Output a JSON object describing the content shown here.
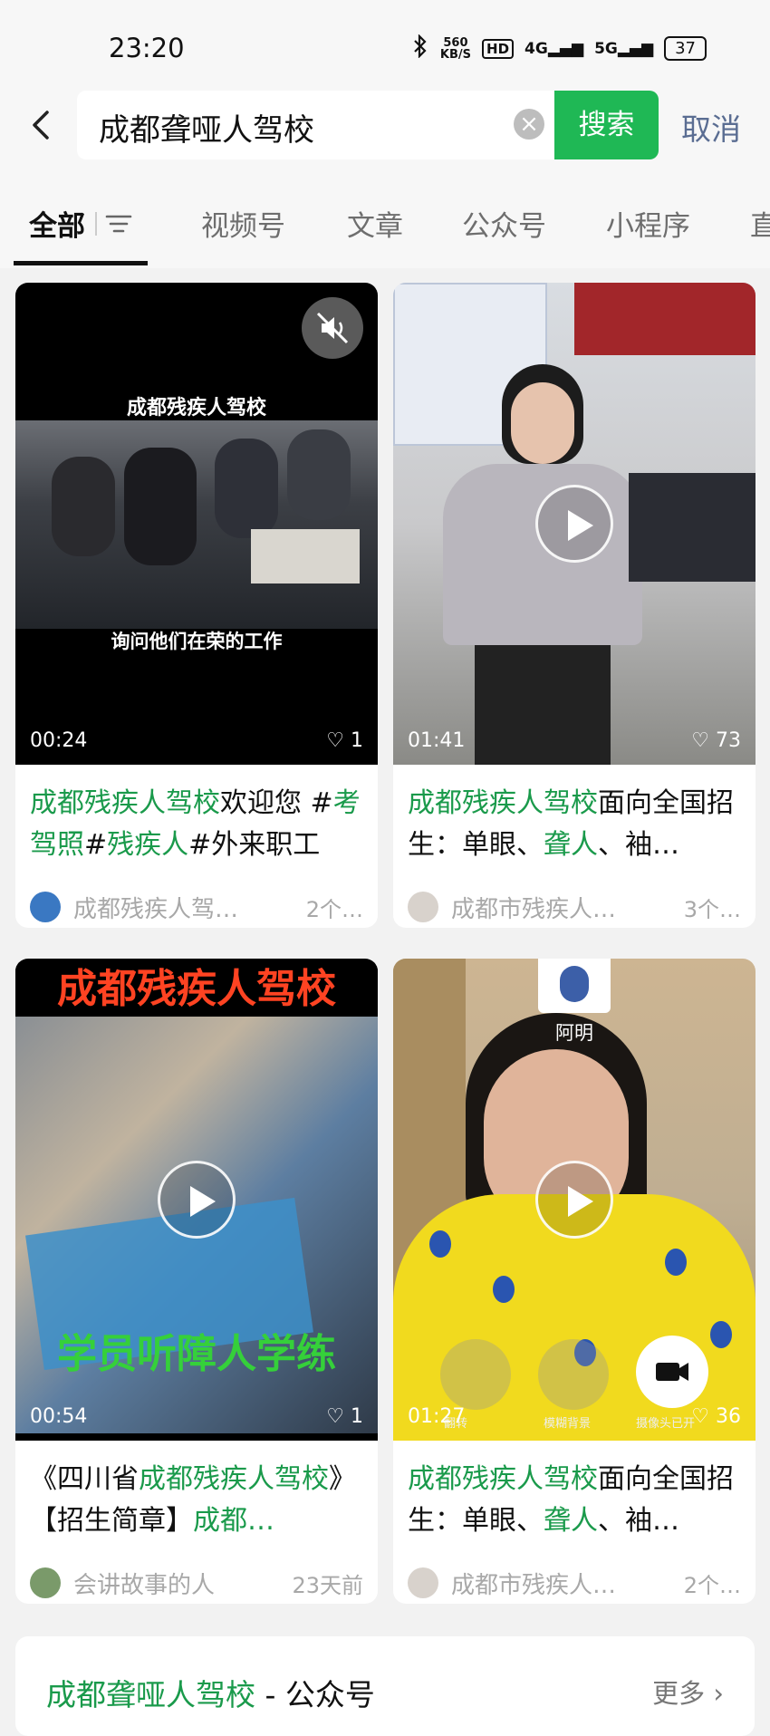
{
  "status": {
    "time": "23:20",
    "speed_top": "560",
    "speed_bottom": "KB/S",
    "hd": "HD",
    "net1": "4G",
    "net2": "5G",
    "battery": "37"
  },
  "search": {
    "query": "成都聋哑人驾校",
    "button": "搜索",
    "cancel": "取消"
  },
  "tabs": [
    "全部",
    "视频号",
    "文章",
    "公众号",
    "小程序",
    "直"
  ],
  "cards": [
    {
      "overlay_top": "成都残疾人驾校",
      "overlay_bottom": "询问他们在荣的工作",
      "duration": "00:24",
      "likes": "1",
      "caption_parts": [
        {
          "t": "成都残疾人驾校",
          "g": true
        },
        {
          "t": "欢迎您 #",
          "g": false
        },
        {
          "t": "考驾照",
          "g": true
        },
        {
          "t": "#",
          "g": false
        },
        {
          "t": "残疾人",
          "g": true
        },
        {
          "t": "#外来职工",
          "g": false
        }
      ],
      "author": "成都残疾人驾…",
      "ago": "2个…"
    },
    {
      "duration": "01:41",
      "likes": "73",
      "caption_parts": [
        {
          "t": "成都残疾人驾校",
          "g": true
        },
        {
          "t": "面向全国招生：单眼、",
          "g": false
        },
        {
          "t": "聋人",
          "g": true
        },
        {
          "t": "、袖…",
          "g": false
        }
      ],
      "author": "成都市残疾人…",
      "ago": "3个…"
    },
    {
      "overlay_top": "成都残疾人驾校",
      "overlay_bottom": "学员听障人学练",
      "duration": "00:54",
      "likes": "1",
      "caption_parts": [
        {
          "t": "《四川省",
          "g": false
        },
        {
          "t": "成都残疾人驾校",
          "g": true
        },
        {
          "t": "》【招生简章】",
          "g": false
        },
        {
          "t": "成都…",
          "g": true
        }
      ],
      "author": "会讲故事的人",
      "ago": "23天前"
    },
    {
      "name_tag": "阿明",
      "cam_labels": [
        "翻转",
        "模糊背景",
        "摄像头已开"
      ],
      "duration": "01:27",
      "likes": "36",
      "caption_parts": [
        {
          "t": "成都残疾人驾校",
          "g": true
        },
        {
          "t": "面向全国招生：单眼、",
          "g": false
        },
        {
          "t": "聋人",
          "g": true
        },
        {
          "t": "、袖…",
          "g": false
        }
      ],
      "author": "成都市残疾人…",
      "ago": "2个…"
    }
  ],
  "bottom": {
    "title_green": "成都聋哑人驾校",
    "title_rest": " - 公众号",
    "more": "更多"
  },
  "colors": {
    "accent": "#1fb855",
    "link_green": "#1a9a4b",
    "cancel_blue": "#5a6d92"
  }
}
